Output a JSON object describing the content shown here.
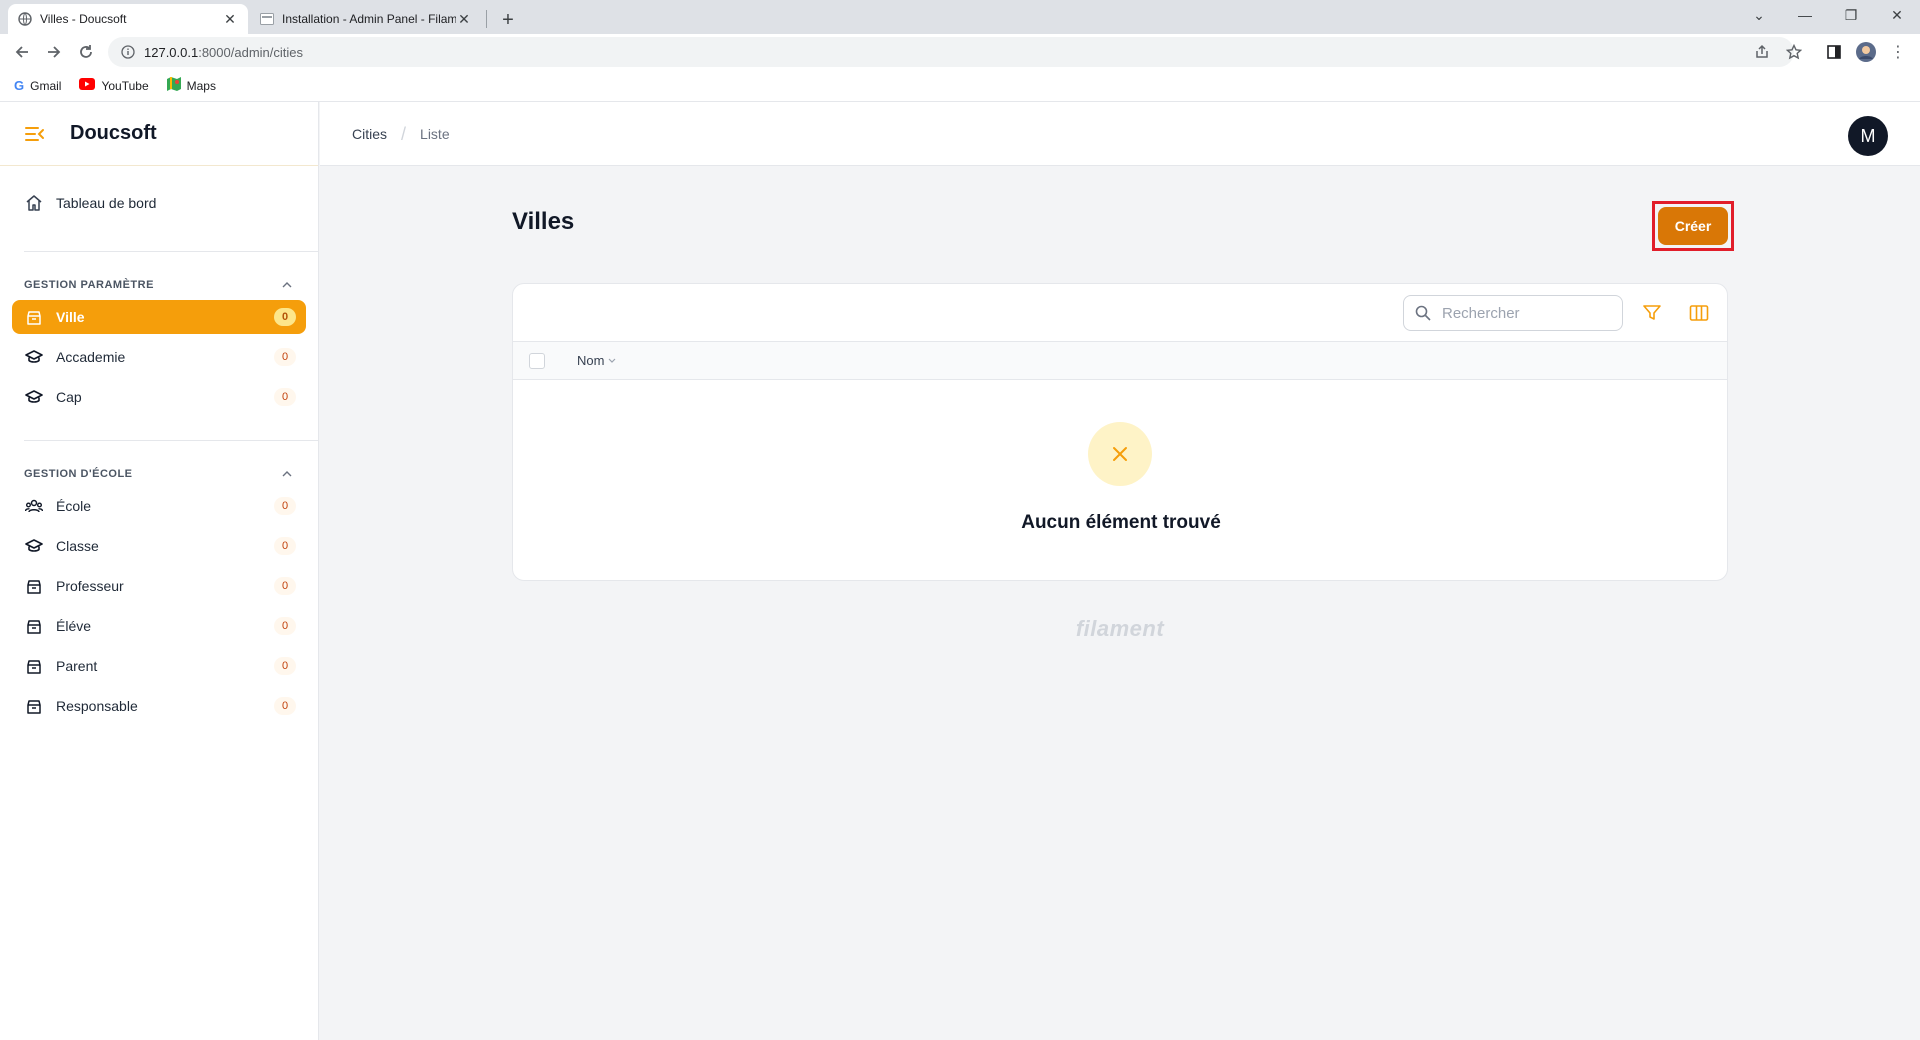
{
  "browser": {
    "tabs": [
      {
        "title": "Villes - Doucsoft",
        "active": true
      },
      {
        "title": "Installation - Admin Panel - Filam",
        "active": false
      }
    ],
    "url_host": "127.0.0.1",
    "url_path": ":8000/admin/cities",
    "bookmarks": [
      {
        "label": "Gmail",
        "icon": "google-icon"
      },
      {
        "label": "YouTube",
        "icon": "youtube-icon"
      },
      {
        "label": "Maps",
        "icon": "maps-icon"
      }
    ]
  },
  "app": {
    "brand": "Doucsoft",
    "accent": "#f59e0b",
    "breadcrumb": {
      "first": "Cities",
      "second": "Liste"
    },
    "avatar_initial": "M"
  },
  "sidebar": {
    "dashboard": {
      "label": "Tableau de bord",
      "icon": "home-icon"
    },
    "groups": [
      {
        "title": "GESTION PARAMÈTRE",
        "items": [
          {
            "label": "Ville",
            "count": "0",
            "active": true,
            "icon": "archive-icon"
          },
          {
            "label": "Accademie",
            "count": "0",
            "active": false,
            "icon": "academic-cap-icon"
          },
          {
            "label": "Cap",
            "count": "0",
            "active": false,
            "icon": "academic-cap-icon"
          }
        ]
      },
      {
        "title": "GESTION D'ÉCOLE",
        "items": [
          {
            "label": "École",
            "count": "0",
            "active": false,
            "icon": "user-group-icon"
          },
          {
            "label": "Classe",
            "count": "0",
            "active": false,
            "icon": "academic-cap-icon"
          },
          {
            "label": "Professeur",
            "count": "0",
            "active": false,
            "icon": "archive-icon"
          },
          {
            "label": "Éléve",
            "count": "0",
            "active": false,
            "icon": "archive-icon"
          },
          {
            "label": "Parent",
            "count": "0",
            "active": false,
            "icon": "archive-icon"
          },
          {
            "label": "Responsable",
            "count": "0",
            "active": false,
            "icon": "archive-icon"
          }
        ]
      }
    ]
  },
  "main": {
    "title": "Villes",
    "create_label": "Créer",
    "search_placeholder": "Rechercher",
    "column_header": "Nom",
    "empty_message": "Aucun élément trouvé",
    "footer_brand": "filament"
  }
}
